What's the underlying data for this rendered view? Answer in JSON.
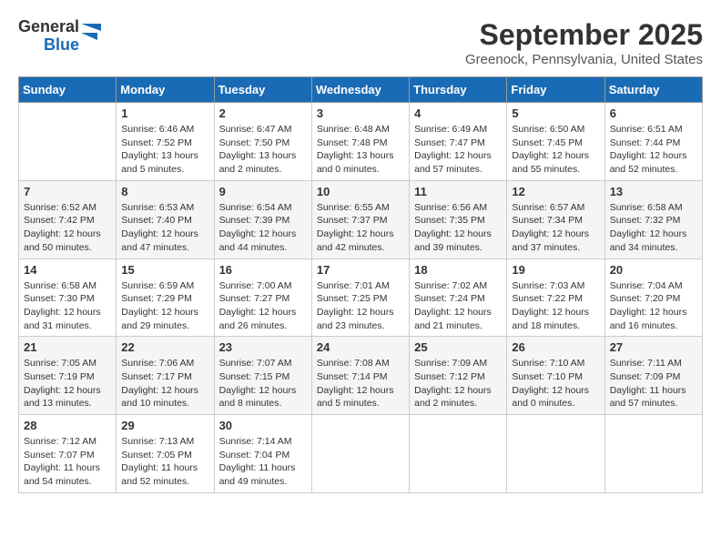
{
  "header": {
    "logo_general": "General",
    "logo_blue": "Blue",
    "month_title": "September 2025",
    "location": "Greenock, Pennsylvania, United States"
  },
  "calendar": {
    "days_of_week": [
      "Sunday",
      "Monday",
      "Tuesday",
      "Wednesday",
      "Thursday",
      "Friday",
      "Saturday"
    ],
    "weeks": [
      [
        {
          "day": "",
          "info": ""
        },
        {
          "day": "1",
          "info": "Sunrise: 6:46 AM\nSunset: 7:52 PM\nDaylight: 13 hours\nand 5 minutes."
        },
        {
          "day": "2",
          "info": "Sunrise: 6:47 AM\nSunset: 7:50 PM\nDaylight: 13 hours\nand 2 minutes."
        },
        {
          "day": "3",
          "info": "Sunrise: 6:48 AM\nSunset: 7:48 PM\nDaylight: 13 hours\nand 0 minutes."
        },
        {
          "day": "4",
          "info": "Sunrise: 6:49 AM\nSunset: 7:47 PM\nDaylight: 12 hours\nand 57 minutes."
        },
        {
          "day": "5",
          "info": "Sunrise: 6:50 AM\nSunset: 7:45 PM\nDaylight: 12 hours\nand 55 minutes."
        },
        {
          "day": "6",
          "info": "Sunrise: 6:51 AM\nSunset: 7:44 PM\nDaylight: 12 hours\nand 52 minutes."
        }
      ],
      [
        {
          "day": "7",
          "info": "Sunrise: 6:52 AM\nSunset: 7:42 PM\nDaylight: 12 hours\nand 50 minutes."
        },
        {
          "day": "8",
          "info": "Sunrise: 6:53 AM\nSunset: 7:40 PM\nDaylight: 12 hours\nand 47 minutes."
        },
        {
          "day": "9",
          "info": "Sunrise: 6:54 AM\nSunset: 7:39 PM\nDaylight: 12 hours\nand 44 minutes."
        },
        {
          "day": "10",
          "info": "Sunrise: 6:55 AM\nSunset: 7:37 PM\nDaylight: 12 hours\nand 42 minutes."
        },
        {
          "day": "11",
          "info": "Sunrise: 6:56 AM\nSunset: 7:35 PM\nDaylight: 12 hours\nand 39 minutes."
        },
        {
          "day": "12",
          "info": "Sunrise: 6:57 AM\nSunset: 7:34 PM\nDaylight: 12 hours\nand 37 minutes."
        },
        {
          "day": "13",
          "info": "Sunrise: 6:58 AM\nSunset: 7:32 PM\nDaylight: 12 hours\nand 34 minutes."
        }
      ],
      [
        {
          "day": "14",
          "info": "Sunrise: 6:58 AM\nSunset: 7:30 PM\nDaylight: 12 hours\nand 31 minutes."
        },
        {
          "day": "15",
          "info": "Sunrise: 6:59 AM\nSunset: 7:29 PM\nDaylight: 12 hours\nand 29 minutes."
        },
        {
          "day": "16",
          "info": "Sunrise: 7:00 AM\nSunset: 7:27 PM\nDaylight: 12 hours\nand 26 minutes."
        },
        {
          "day": "17",
          "info": "Sunrise: 7:01 AM\nSunset: 7:25 PM\nDaylight: 12 hours\nand 23 minutes."
        },
        {
          "day": "18",
          "info": "Sunrise: 7:02 AM\nSunset: 7:24 PM\nDaylight: 12 hours\nand 21 minutes."
        },
        {
          "day": "19",
          "info": "Sunrise: 7:03 AM\nSunset: 7:22 PM\nDaylight: 12 hours\nand 18 minutes."
        },
        {
          "day": "20",
          "info": "Sunrise: 7:04 AM\nSunset: 7:20 PM\nDaylight: 12 hours\nand 16 minutes."
        }
      ],
      [
        {
          "day": "21",
          "info": "Sunrise: 7:05 AM\nSunset: 7:19 PM\nDaylight: 12 hours\nand 13 minutes."
        },
        {
          "day": "22",
          "info": "Sunrise: 7:06 AM\nSunset: 7:17 PM\nDaylight: 12 hours\nand 10 minutes."
        },
        {
          "day": "23",
          "info": "Sunrise: 7:07 AM\nSunset: 7:15 PM\nDaylight: 12 hours\nand 8 minutes."
        },
        {
          "day": "24",
          "info": "Sunrise: 7:08 AM\nSunset: 7:14 PM\nDaylight: 12 hours\nand 5 minutes."
        },
        {
          "day": "25",
          "info": "Sunrise: 7:09 AM\nSunset: 7:12 PM\nDaylight: 12 hours\nand 2 minutes."
        },
        {
          "day": "26",
          "info": "Sunrise: 7:10 AM\nSunset: 7:10 PM\nDaylight: 12 hours\nand 0 minutes."
        },
        {
          "day": "27",
          "info": "Sunrise: 7:11 AM\nSunset: 7:09 PM\nDaylight: 11 hours\nand 57 minutes."
        }
      ],
      [
        {
          "day": "28",
          "info": "Sunrise: 7:12 AM\nSunset: 7:07 PM\nDaylight: 11 hours\nand 54 minutes."
        },
        {
          "day": "29",
          "info": "Sunrise: 7:13 AM\nSunset: 7:05 PM\nDaylight: 11 hours\nand 52 minutes."
        },
        {
          "day": "30",
          "info": "Sunrise: 7:14 AM\nSunset: 7:04 PM\nDaylight: 11 hours\nand 49 minutes."
        },
        {
          "day": "",
          "info": ""
        },
        {
          "day": "",
          "info": ""
        },
        {
          "day": "",
          "info": ""
        },
        {
          "day": "",
          "info": ""
        }
      ]
    ]
  }
}
